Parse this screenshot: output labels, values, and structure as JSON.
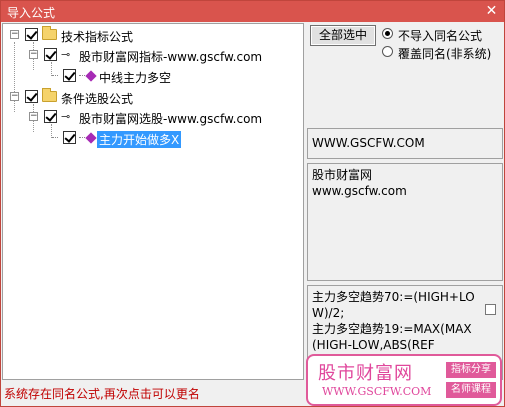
{
  "window": {
    "title": "导入公式",
    "close_glyph": "✕"
  },
  "tree": {
    "nodes": [
      {
        "label": "技术指标公式",
        "type": "folder"
      },
      {
        "label": "股市财富网指标-www.gscfw.com",
        "type": "key"
      },
      {
        "label": "中线主力多空",
        "type": "formula"
      },
      {
        "label": "条件选股公式",
        "type": "folder"
      },
      {
        "label": "股市财富网选股-www.gscfw.com",
        "type": "key"
      },
      {
        "label": "主力开始做多X",
        "type": "formula",
        "selected": true
      }
    ]
  },
  "options": {
    "select_all_label": "全部选中",
    "radio_skip_label": "不导入同名公式",
    "radio_overwrite_label": "覆盖同名(非系统)",
    "selected": "skip"
  },
  "info": {
    "url": "WWW.GSCFW.COM",
    "desc_line1": "股市财富网",
    "desc_line2": "www.gscfw.com",
    "formula_text": "主力多空趋势70:=(HIGH+LOW)/2;\n主力多空趋势19:=MAX(MAX(HIGH-LOW,ABS(REF"
  },
  "status": {
    "message": "系统存在同名公式,再次点击可以更名"
  },
  "watermark": {
    "title": "股市财富网",
    "url": "WWW.GSCFW.COM",
    "tag1": "指标分享",
    "tag2": "名师课程"
  },
  "colors": {
    "titlebar": "#d9544d",
    "selection": "#3399ff",
    "status_text": "#c00000",
    "brand_pink": "#e0479c"
  }
}
